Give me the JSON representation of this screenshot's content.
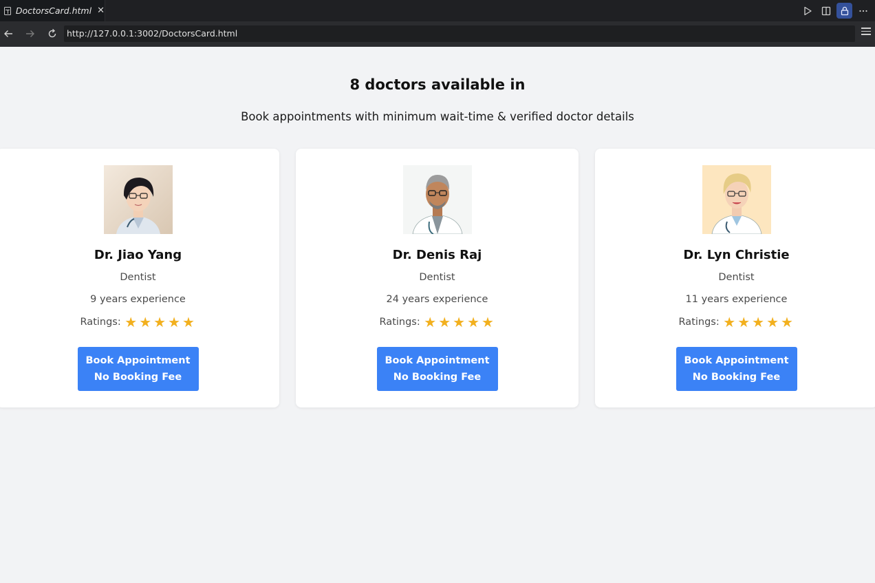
{
  "editor": {
    "tab_title": "DoctorsCard.html",
    "close_glyph": "✕"
  },
  "browser": {
    "url": "http://127.0.0.1:3002/DoctorsCard.html"
  },
  "page": {
    "heading": "8 doctors available in",
    "subheading": "Book appointments with minimum wait-time & verified doctor details"
  },
  "doctors": [
    {
      "name": "Dr. Jiao Yang",
      "specialty": "Dentist",
      "experience": "9 years experience",
      "ratings_label": "Ratings:",
      "stars": 5,
      "button_line1": "Book Appointment",
      "button_line2": "No Booking Fee"
    },
    {
      "name": "Dr. Denis Raj",
      "specialty": "Dentist",
      "experience": "24 years experience",
      "ratings_label": "Ratings:",
      "stars": 5,
      "button_line1": "Book Appointment",
      "button_line2": "No Booking Fee"
    },
    {
      "name": "Dr. Lyn Christie",
      "specialty": "Dentist",
      "experience": "11 years experience",
      "ratings_label": "Ratings:",
      "stars": 5,
      "button_line1": "Book Appointment",
      "button_line2": "No Booking Fee"
    }
  ],
  "icons": {
    "star": "★",
    "tab_icon": "preview-icon",
    "actions": [
      "run-icon",
      "split-editor-icon",
      "lock-icon",
      "more-icon"
    ],
    "nav": [
      "back-icon",
      "forward-icon",
      "reload-icon",
      "menu-icon"
    ]
  },
  "colors": {
    "button": "#3b82f6",
    "star": "#f2b01e",
    "page_bg": "#f2f3f5",
    "lock_active": "#34519b"
  }
}
